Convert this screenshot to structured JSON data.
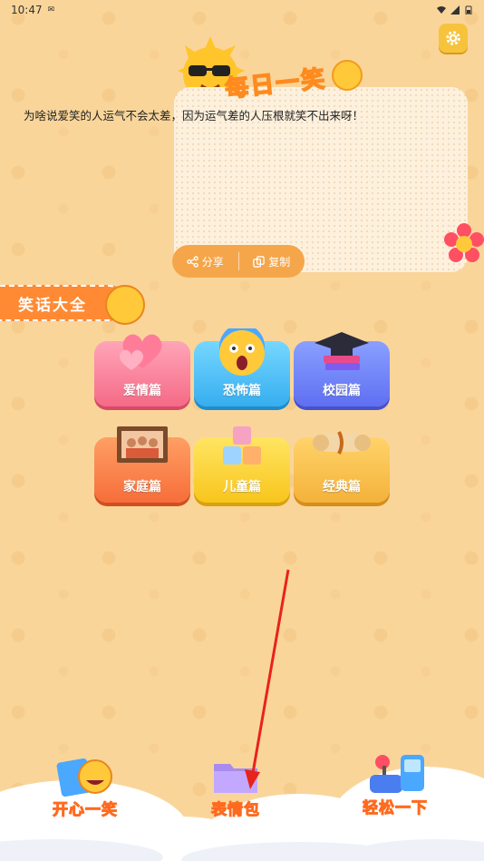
{
  "status_bar": {
    "time": "10:47"
  },
  "header": {
    "title_art": "每日一笑"
  },
  "joke": {
    "text": "为啥说爱笑的人运气不会太差，因为运气差的人压根就笑不出来呀！"
  },
  "actions": {
    "share_label": "分享",
    "copy_label": "复制"
  },
  "section": {
    "title": "笑话大全"
  },
  "categories": [
    {
      "label": "爱情篇",
      "color": "#f56a86"
    },
    {
      "label": "恐怖篇",
      "color": "#36aef0"
    },
    {
      "label": "校园篇",
      "color": "#5f6ff2"
    },
    {
      "label": "家庭篇",
      "color": "#f76d3a"
    },
    {
      "label": "儿童篇",
      "color": "#f8c51d"
    },
    {
      "label": "经典篇",
      "color": "#f4b23a"
    }
  ],
  "bottom_nav": [
    {
      "label": "开心一笑"
    },
    {
      "label": "表情包"
    },
    {
      "label": "轻松一下"
    }
  ],
  "colors": {
    "background": "#fad59a",
    "accent": "#ff8a33",
    "annotation_arrow": "#e8231a"
  }
}
